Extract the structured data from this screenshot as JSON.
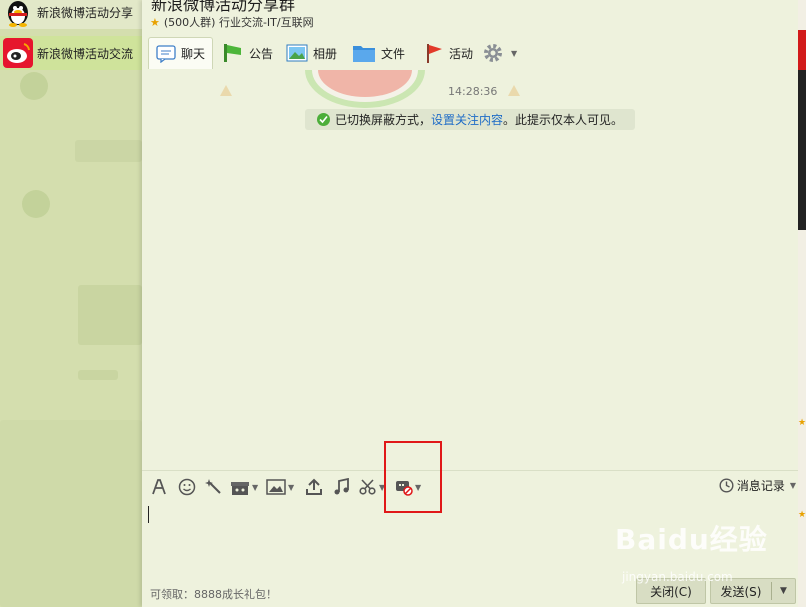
{
  "contacts": [
    {
      "name": "新浪微博活动分享",
      "avatar_icon": "qq-penguin-icon"
    },
    {
      "name": "新浪微博活动交流",
      "avatar_icon": "weibo-logo-icon"
    }
  ],
  "window": {
    "title": "新浪微博活动分享群",
    "subtitle": "(500人群) 行业交流-IT/互联网"
  },
  "tabs": [
    {
      "label": "聊天",
      "icon": "chat-bubble-icon"
    },
    {
      "label": "公告",
      "icon": "announcement-flag-icon"
    },
    {
      "label": "相册",
      "icon": "photo-album-icon"
    },
    {
      "label": "文件",
      "icon": "folder-icon"
    },
    {
      "label": "活动",
      "icon": "event-flag-icon"
    }
  ],
  "chat": {
    "timestamp": "14:28:36",
    "notice_prefix": "已切换屏蔽方式，",
    "notice_link": "设置关注内容",
    "notice_suffix": "。此提示仅本人可见。"
  },
  "toolbar": {
    "history_label": "消息记录",
    "icons": [
      "font-icon",
      "emoji-icon",
      "magic-wand-icon",
      "gift-box-icon",
      "image-icon",
      "upload-icon",
      "music-icon",
      "scissors-icon",
      "block-message-icon"
    ]
  },
  "footer": {
    "gift_text": "可领取：8888成长礼包！",
    "close_label": "关闭(C)",
    "send_label": "发送(S)"
  },
  "watermark": {
    "logo": "Baidu经验",
    "url": "jingyan.baidu.com"
  },
  "colors": {
    "accent_red": "#e01818",
    "link": "#1e6cc7",
    "ok_green": "#4cae3a"
  }
}
